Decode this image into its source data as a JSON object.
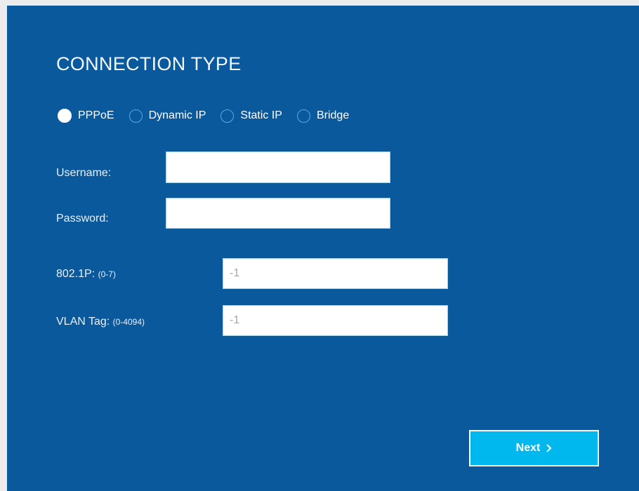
{
  "title": "CONNECTION TYPE",
  "connection_options": [
    {
      "label": "PPPoE",
      "checked": true
    },
    {
      "label": "Dynamic IP",
      "checked": false
    },
    {
      "label": "Static IP",
      "checked": false
    },
    {
      "label": "Bridge",
      "checked": false
    }
  ],
  "username": {
    "label": "Username:",
    "value": ""
  },
  "password": {
    "label": "Password:",
    "value": ""
  },
  "priority": {
    "label": "802.1P:",
    "hint": "(0-7)",
    "value": "-1"
  },
  "vlan": {
    "label": "VLAN Tag:",
    "hint": "(0-4094)",
    "value": "-1"
  },
  "next_button": {
    "label": "Next",
    "icon": "chevron-right-icon"
  },
  "colors": {
    "panel": "#0a599c",
    "accent": "#00b7ee",
    "radio_border": "#5ba9e2"
  }
}
